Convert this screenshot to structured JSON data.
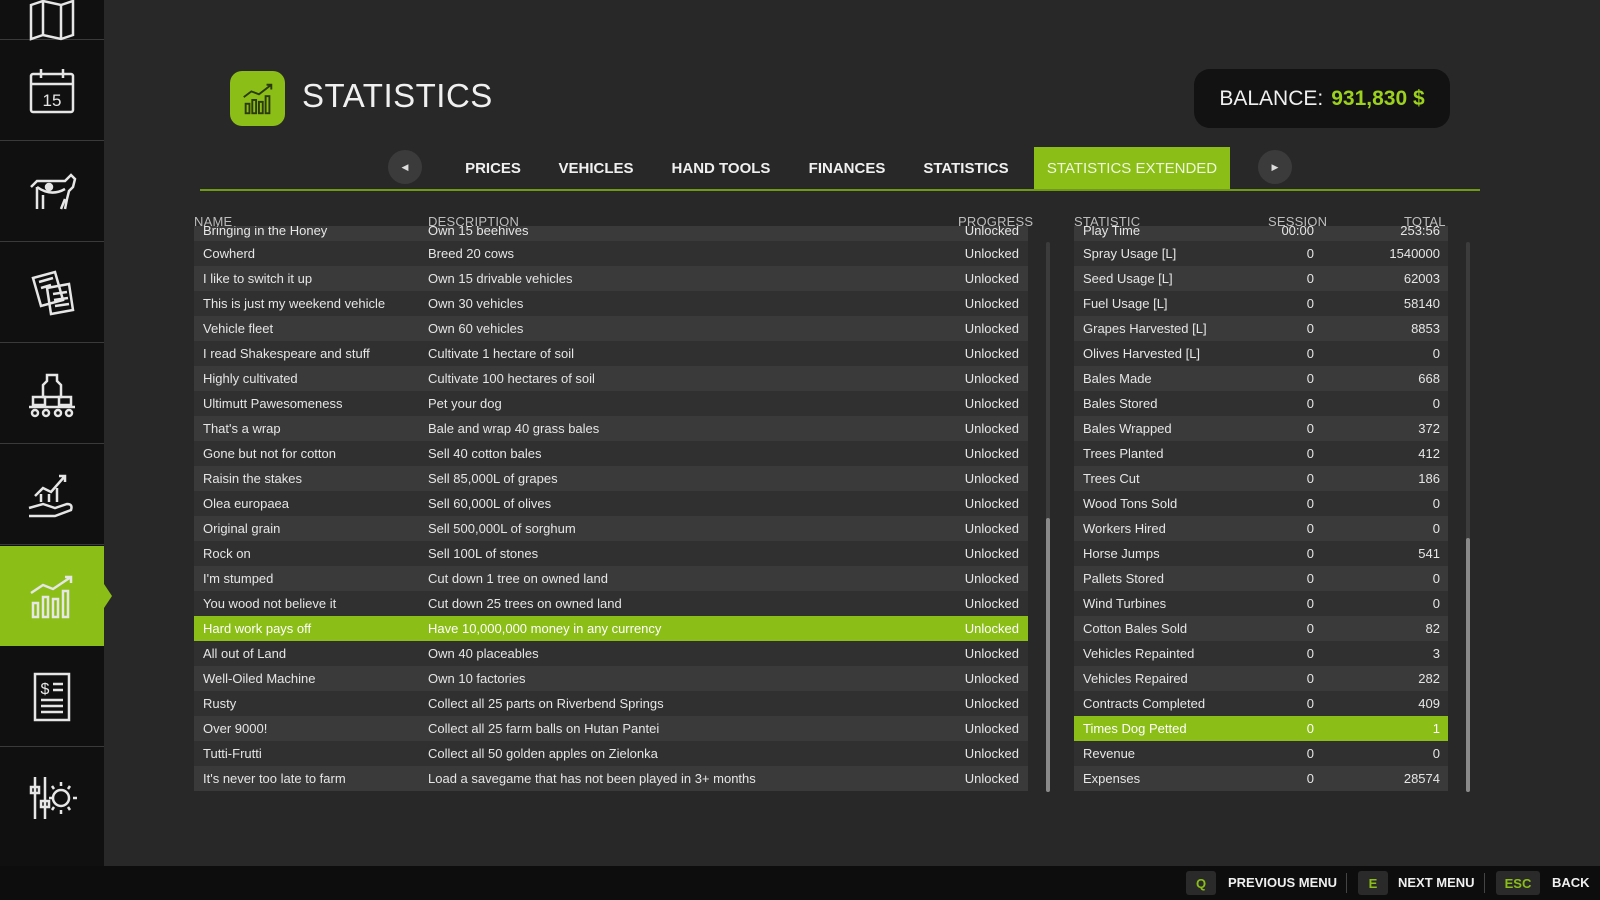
{
  "sidebar": {
    "items": [
      {
        "icon": "map-icon",
        "active": false
      },
      {
        "icon": "calendar-icon",
        "label": "15",
        "active": false
      },
      {
        "icon": "animals-icon",
        "active": false
      },
      {
        "icon": "contracts-icon",
        "active": false
      },
      {
        "icon": "production-icon",
        "active": false
      },
      {
        "icon": "prices-icon",
        "active": false
      },
      {
        "icon": "statistics-icon",
        "active": true
      },
      {
        "icon": "finances-icon",
        "active": false
      },
      {
        "icon": "settings-icon",
        "active": false
      }
    ]
  },
  "header": {
    "title": "STATISTICS",
    "balance_label": "BALANCE:",
    "balance_value": "931,830 $"
  },
  "tabs": [
    {
      "label": "PRICES",
      "active": false
    },
    {
      "label": "VEHICLES",
      "active": false
    },
    {
      "label": "HAND TOOLS",
      "active": false
    },
    {
      "label": "FINANCES",
      "active": false
    },
    {
      "label": "STATISTICS",
      "active": false
    },
    {
      "label": "STATISTICS EXTENDED",
      "active": true
    }
  ],
  "achievements": {
    "headers": {
      "name": "NAME",
      "description": "DESCRIPTION",
      "progress": "PROGRESS"
    },
    "rows": [
      {
        "name": "Bringing in the Honey",
        "description": "Own 15 beehives",
        "progress": "Unlocked"
      },
      {
        "name": "Cowherd",
        "description": "Breed 20 cows",
        "progress": "Unlocked"
      },
      {
        "name": "I like to switch it up",
        "description": "Own 15 drivable vehicles",
        "progress": "Unlocked"
      },
      {
        "name": "This is just my weekend vehicle",
        "description": "Own 30 vehicles",
        "progress": "Unlocked"
      },
      {
        "name": "Vehicle fleet",
        "description": "Own 60 vehicles",
        "progress": "Unlocked"
      },
      {
        "name": "I read Shakespeare and stuff",
        "description": "Cultivate 1 hectare of soil",
        "progress": "Unlocked"
      },
      {
        "name": "Highly cultivated",
        "description": "Cultivate 100 hectares of soil",
        "progress": "Unlocked"
      },
      {
        "name": "Ultimutt Pawesomeness",
        "description": "Pet your dog",
        "progress": "Unlocked"
      },
      {
        "name": "That's a wrap",
        "description": "Bale and wrap 40 grass bales",
        "progress": "Unlocked"
      },
      {
        "name": "Gone but not for cotton",
        "description": "Sell 40 cotton bales",
        "progress": "Unlocked"
      },
      {
        "name": "Raisin the stakes",
        "description": "Sell 85,000L of grapes",
        "progress": "Unlocked"
      },
      {
        "name": "Olea europaea",
        "description": "Sell 60,000L of olives",
        "progress": "Unlocked"
      },
      {
        "name": "Original grain",
        "description": "Sell 500,000L of sorghum",
        "progress": "Unlocked"
      },
      {
        "name": "Rock on",
        "description": "Sell 100L of stones",
        "progress": "Unlocked"
      },
      {
        "name": "I'm stumped",
        "description": "Cut down 1 tree on owned land",
        "progress": "Unlocked"
      },
      {
        "name": "You wood not believe it",
        "description": "Cut down 25 trees on owned land",
        "progress": "Unlocked"
      },
      {
        "name": "Hard work pays off",
        "description": "Have 10,000,000 money in any currency",
        "progress": "Unlocked",
        "selected": true
      },
      {
        "name": "All out of Land",
        "description": "Own 40 placeables",
        "progress": "Unlocked"
      },
      {
        "name": "Well-Oiled Machine",
        "description": "Own 10 factories",
        "progress": "Unlocked"
      },
      {
        "name": "Rusty",
        "description": "Collect all 25 parts on Riverbend Springs",
        "progress": "Unlocked"
      },
      {
        "name": "Over 9000!",
        "description": "Collect all 25 farm balls on Hutan Pantei",
        "progress": "Unlocked"
      },
      {
        "name": "Tutti-Frutti",
        "description": "Collect all 50 golden apples on Zielonka",
        "progress": "Unlocked"
      },
      {
        "name": "It's never too late to farm",
        "description": "Load a savegame that has not been played in 3+ months",
        "progress": "Unlocked"
      }
    ]
  },
  "statistics": {
    "headers": {
      "statistic": "STATISTIC",
      "session": "SESSION",
      "total": "TOTAL"
    },
    "rows": [
      {
        "name": "Play Time",
        "session": "00:00",
        "total": "253:56"
      },
      {
        "name": "Spray Usage [L]",
        "session": "0",
        "total": "1540000"
      },
      {
        "name": "Seed Usage [L]",
        "session": "0",
        "total": "62003"
      },
      {
        "name": "Fuel Usage [L]",
        "session": "0",
        "total": "58140"
      },
      {
        "name": "Grapes Harvested [L]",
        "session": "0",
        "total": "8853"
      },
      {
        "name": "Olives Harvested [L]",
        "session": "0",
        "total": "0"
      },
      {
        "name": "Bales Made",
        "session": "0",
        "total": "668"
      },
      {
        "name": "Bales Stored",
        "session": "0",
        "total": "0"
      },
      {
        "name": "Bales Wrapped",
        "session": "0",
        "total": "372"
      },
      {
        "name": "Trees Planted",
        "session": "0",
        "total": "412"
      },
      {
        "name": "Trees Cut",
        "session": "0",
        "total": "186"
      },
      {
        "name": "Wood Tons Sold",
        "session": "0",
        "total": "0"
      },
      {
        "name": "Workers Hired",
        "session": "0",
        "total": "0"
      },
      {
        "name": "Horse Jumps",
        "session": "0",
        "total": "541"
      },
      {
        "name": "Pallets Stored",
        "session": "0",
        "total": "0"
      },
      {
        "name": "Wind Turbines",
        "session": "0",
        "total": "0"
      },
      {
        "name": "Cotton Bales Sold",
        "session": "0",
        "total": "82"
      },
      {
        "name": "Vehicles Repainted",
        "session": "0",
        "total": "3"
      },
      {
        "name": "Vehicles Repaired",
        "session": "0",
        "total": "282"
      },
      {
        "name": "Contracts Completed",
        "session": "0",
        "total": "409"
      },
      {
        "name": "Times Dog Petted",
        "session": "0",
        "total": "1",
        "selected": true
      },
      {
        "name": "Revenue",
        "session": "0",
        "total": "0"
      },
      {
        "name": "Expenses",
        "session": "0",
        "total": "28574"
      }
    ]
  },
  "bottom_bar": {
    "prev": {
      "key": "Q",
      "label": "PREVIOUS MENU"
    },
    "next": {
      "key": "E",
      "label": "NEXT MENU"
    },
    "back": {
      "key": "ESC",
      "label": "BACK"
    }
  },
  "colors": {
    "accent": "#8cbe18",
    "balance": "#9cd11d",
    "background": "#282828",
    "sidebar": "#101010"
  }
}
